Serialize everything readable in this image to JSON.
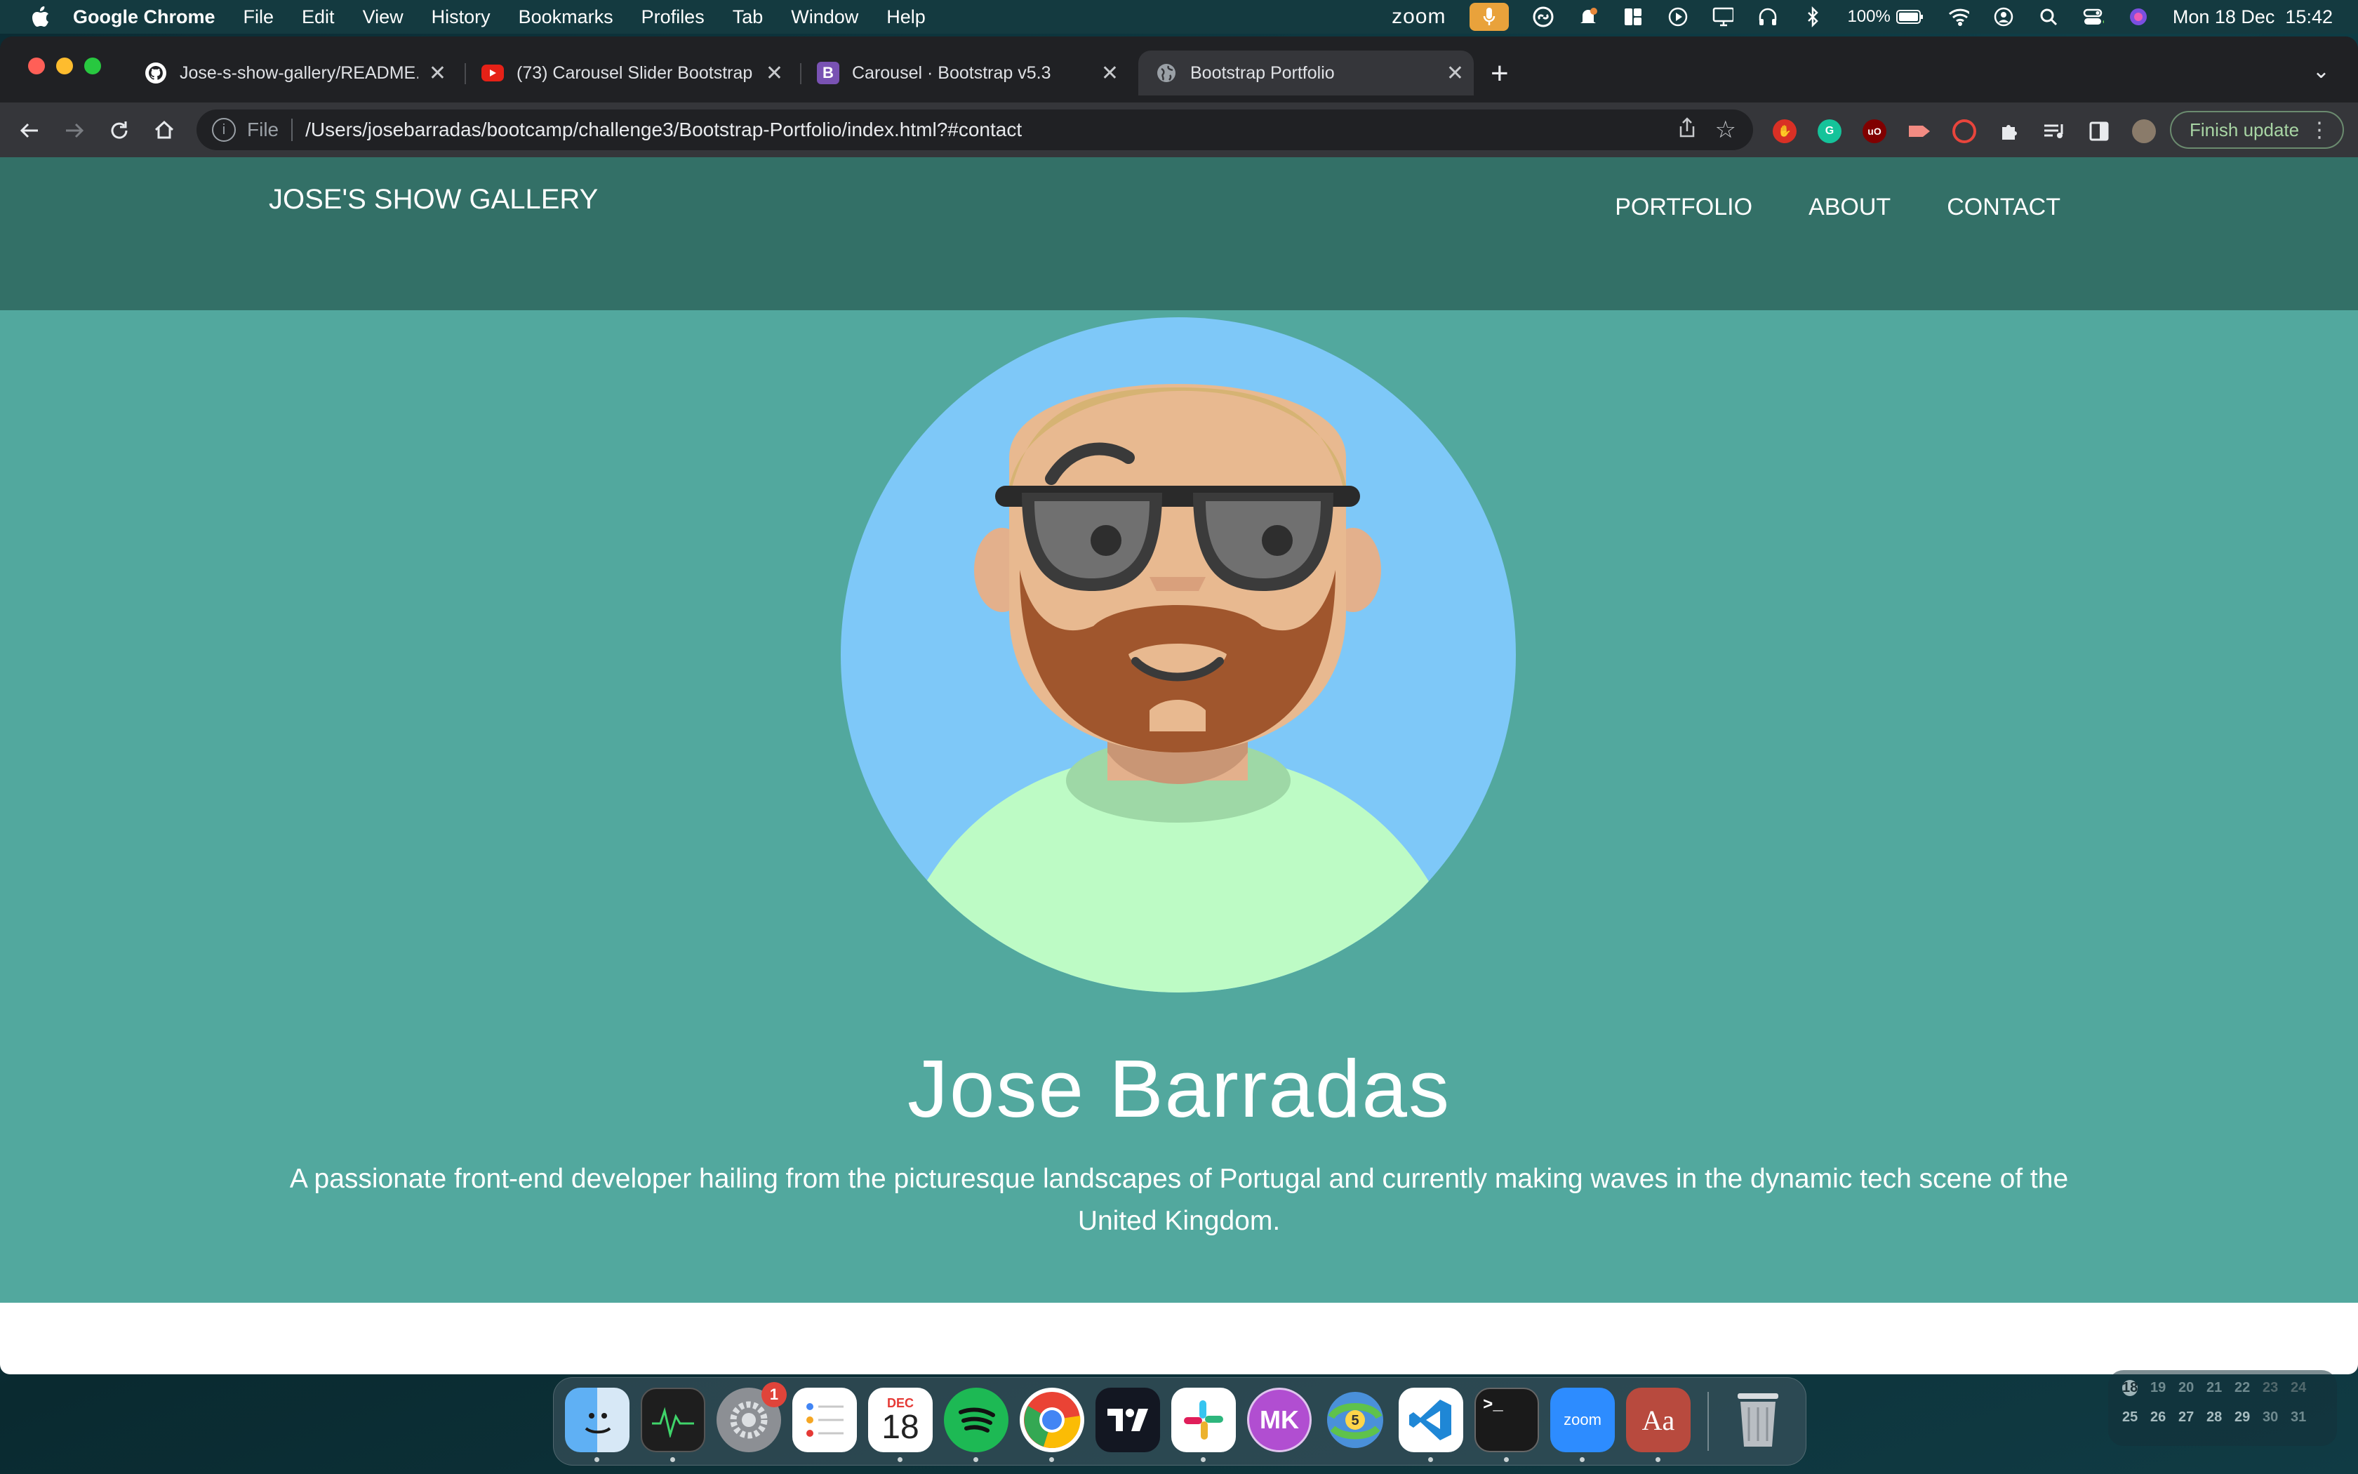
{
  "menubar": {
    "app": "Google Chrome",
    "items": [
      "File",
      "Edit",
      "View",
      "History",
      "Bookmarks",
      "Profiles",
      "Tab",
      "Window",
      "Help"
    ],
    "zoom": "zoom",
    "battery": "100%",
    "datetime": "Mon 18 Dec  15:42"
  },
  "tabs": [
    {
      "label": "Jose-s-show-gallery/README.md",
      "icon": "github-icon"
    },
    {
      "label": "(73) Carousel Slider Bootstrap",
      "icon": "youtube-icon"
    },
    {
      "label": "Carousel · Bootstrap v5.3",
      "icon": "bootstrap-icon"
    },
    {
      "label": "Bootstrap Portfolio",
      "icon": "globe-icon"
    }
  ],
  "omnibox": {
    "scheme": "File",
    "url": "/Users/josebarradas/bootcamp/challenge3/Bootstrap-Portfolio/index.html?#contact"
  },
  "finish_update": "Finish update",
  "site": {
    "brand": "JOSE'S SHOW GALLERY",
    "nav": [
      "PORTFOLIO",
      "ABOUT",
      "CONTACT"
    ],
    "name": "Jose Barradas",
    "bio": "A passionate front-end developer hailing from the picturesque landscapes of Portugal and currently making waves in the dynamic tech scene of the United Kingdom."
  },
  "dock": {
    "calendar_month": "DEC",
    "calendar_day": "18",
    "settings_badge": "1",
    "mk": "MK",
    "zoom": "zoom",
    "dict": "Aa"
  },
  "cal_widget": {
    "row1": [
      "18",
      "19",
      "20",
      "21",
      "22",
      "23",
      "24"
    ],
    "row2": [
      "25",
      "26",
      "27",
      "28",
      "29",
      "30",
      "31"
    ]
  },
  "colors": {
    "navbar": "#337067",
    "hero": "#52a89e",
    "avatar_bg": "#7ec8f8",
    "shirt": "#bdfbc5"
  }
}
